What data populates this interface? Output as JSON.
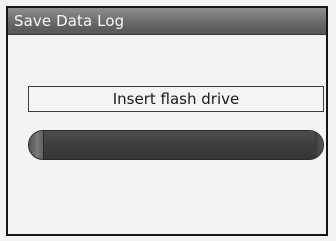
{
  "window": {
    "title": "Save Data Log"
  },
  "message": {
    "text": "Insert flash drive"
  },
  "progress": {
    "percent": 100
  },
  "colors": {
    "title_bar": "#6a6a6a",
    "screen_background": "#f3f3f3",
    "progress_bar": "#404040"
  }
}
